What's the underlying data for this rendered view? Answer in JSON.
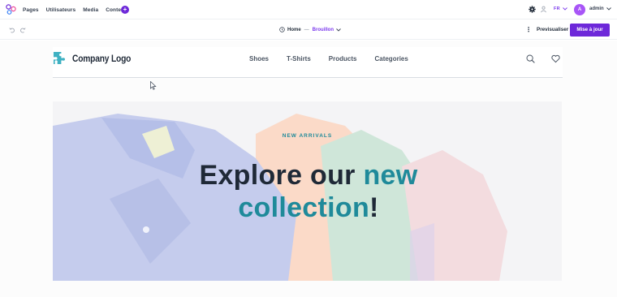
{
  "topbar": {
    "nav": [
      "Pages",
      "Utilisateurs",
      "Media",
      "Content"
    ],
    "add_label": "+",
    "language": "FR",
    "avatar_initial": "A",
    "user_name": "admin"
  },
  "editor": {
    "breadcrumb_home": "Home",
    "breadcrumb_sep": "—",
    "status": "Brouillon",
    "kebab": "⋮",
    "preview_label": "Previsualiser",
    "update_label": "Mise à jour"
  },
  "site": {
    "logo_text": "Company Logo",
    "nav": [
      "Shoes",
      "T-Shirts",
      "Products",
      "Categories"
    ]
  },
  "hero": {
    "eyebrow": "NEW ARRIVALS",
    "headline_part1": "Explore our ",
    "headline_highlight1": "new",
    "headline_highlight2": "collection",
    "headline_end": "!"
  },
  "colors": {
    "accent": "#6d28d9",
    "teal": "#1f8a9a",
    "text": "#1f2937"
  },
  "icons": [
    "app-logo-icon",
    "gear-icon",
    "users-icon",
    "chevron-down-icon",
    "undo-icon",
    "redo-icon",
    "clock-icon",
    "puzzle-logo-icon",
    "search-icon",
    "heart-icon",
    "cursor-icon"
  ]
}
